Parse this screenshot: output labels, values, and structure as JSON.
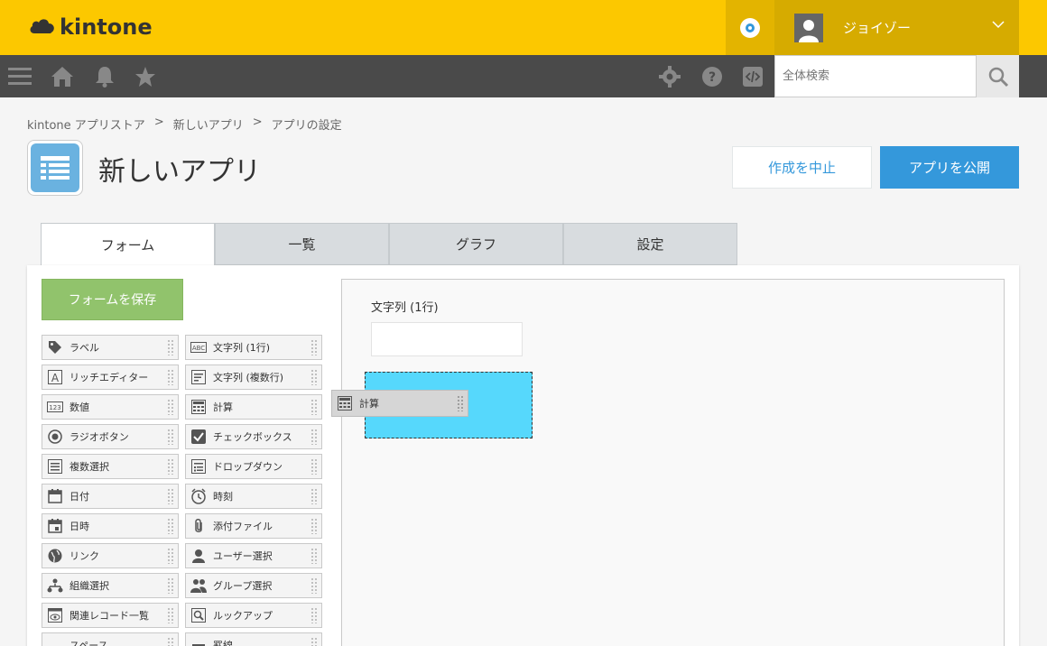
{
  "header": {
    "logo_text": "kintone",
    "user_name": "ジョイゾー"
  },
  "nav": {
    "search_placeholder": "全体検索"
  },
  "breadcrumb": [
    "kintone アプリストア",
    ">",
    "新しいアプリ",
    ">",
    "アプリの設定"
  ],
  "app": {
    "title": "新しいアプリ"
  },
  "actions": {
    "cancel_label": "作成を中止",
    "publish_label": "アプリを公開"
  },
  "tabs": [
    {
      "label": "フォーム",
      "active": true
    },
    {
      "label": "一覧",
      "active": false
    },
    {
      "label": "グラフ",
      "active": false
    },
    {
      "label": "設定",
      "active": false
    }
  ],
  "form": {
    "save_label": "フォームを保存",
    "palette": [
      {
        "label": "ラベル",
        "icon": "tag-icon"
      },
      {
        "label": "文字列 (1行)",
        "icon": "abc-icon"
      },
      {
        "label": "リッチエディター",
        "icon": "rich-editor-icon"
      },
      {
        "label": "文字列 (複数行)",
        "icon": "multiline-text-icon"
      },
      {
        "label": "数値",
        "icon": "number-icon"
      },
      {
        "label": "計算",
        "icon": "calculator-icon"
      },
      {
        "label": "ラジオボタン",
        "icon": "radio-icon"
      },
      {
        "label": "チェックボックス",
        "icon": "checkbox-icon"
      },
      {
        "label": "複数選択",
        "icon": "multi-select-icon"
      },
      {
        "label": "ドロップダウン",
        "icon": "dropdown-icon"
      },
      {
        "label": "日付",
        "icon": "calendar-icon"
      },
      {
        "label": "時刻",
        "icon": "clock-icon"
      },
      {
        "label": "日時",
        "icon": "datetime-icon"
      },
      {
        "label": "添付ファイル",
        "icon": "paperclip-icon"
      },
      {
        "label": "リンク",
        "icon": "globe-icon"
      },
      {
        "label": "ユーザー選択",
        "icon": "user-icon"
      },
      {
        "label": "組織選択",
        "icon": "org-icon"
      },
      {
        "label": "グループ選択",
        "icon": "group-icon"
      },
      {
        "label": "関連レコード一覧",
        "icon": "related-records-icon"
      },
      {
        "label": "ルックアップ",
        "icon": "lookup-icon"
      },
      {
        "label": "スペース",
        "icon": "space-icon"
      },
      {
        "label": "罫線",
        "icon": "border-icon"
      }
    ],
    "canvas_field_label": "文字列 (1行)",
    "dragging_label": "計算"
  },
  "colors": {
    "header_yellow": "#fcc800",
    "nav_dark": "#4a4a4a",
    "accent_blue": "#3498db",
    "save_green": "#91c36c",
    "drop_cyan": "#56d8fc"
  }
}
